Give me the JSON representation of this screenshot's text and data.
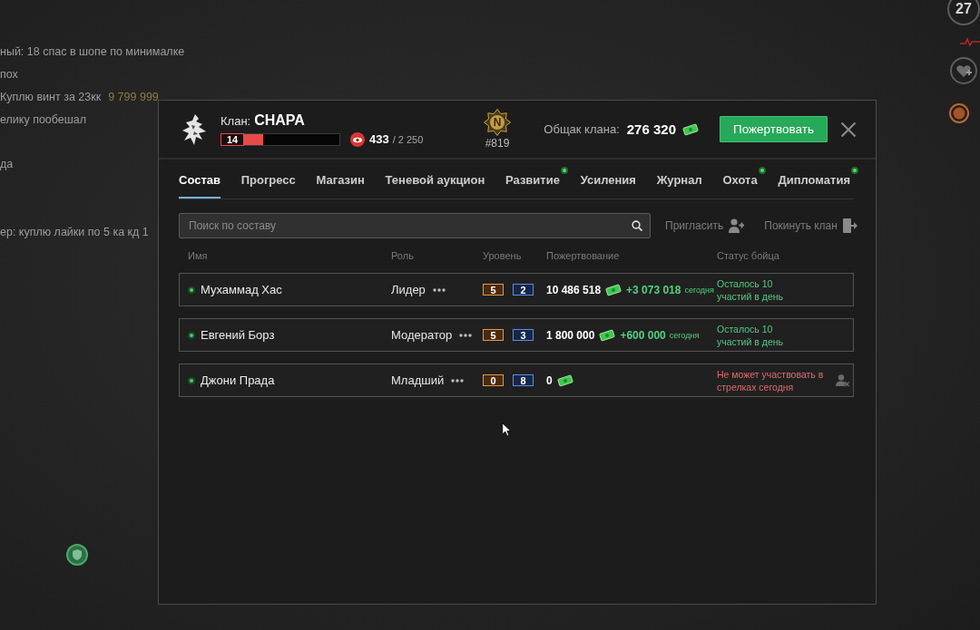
{
  "chat": [
    {
      "messages": [
        {
          "text": "ный: 18 спас в шопе по минималке"
        },
        {
          "text": "пох"
        },
        {
          "text": "Куплю винт за 23кк",
          "amount": "9 799 999"
        },
        {
          "text": "елику пообешал"
        }
      ]
    },
    {
      "messages": [
        {
          "text": "да"
        }
      ]
    },
    {
      "messages": [
        {
          "text": "ер: куплю лайки по 5 ка кд 1"
        }
      ]
    }
  ],
  "hud": {
    "counter": "27"
  },
  "clan": {
    "label": "Клан:",
    "name": "CHAPA",
    "clan_lvl": "14",
    "progress": {
      "level": 0.35
    },
    "points": "433",
    "points_max": "/ 2 250",
    "league_letter": "N",
    "rank": "#819",
    "treasury_label": "Общак клана:",
    "treasury": "276 320",
    "donate_button": "Пожертвовать"
  },
  "tabs": [
    {
      "label": "Состав",
      "selected": true,
      "notification": false
    },
    {
      "label": "Прогресс",
      "selected": false,
      "notification": false
    },
    {
      "label": "Магазин",
      "selected": false,
      "notification": false
    },
    {
      "label": "Теневой аукцион",
      "selected": false,
      "notification": false
    },
    {
      "label": "Развитие",
      "selected": false,
      "notification": true
    },
    {
      "label": "Усиления",
      "selected": false,
      "notification": false
    },
    {
      "label": "Журнал",
      "selected": false,
      "notification": false
    },
    {
      "label": "Охота",
      "selected": false,
      "notification": true
    },
    {
      "label": "Дипломатия",
      "selected": false,
      "notification": true
    }
  ],
  "search": {
    "placeholder": "Поиск по составу"
  },
  "actions": [
    {
      "label": "Пригласить",
      "kind": "invite"
    },
    {
      "label": "Покинуть клан",
      "kind": "leave"
    }
  ],
  "table": {
    "columns": [
      "Имя",
      "Роль",
      "Уровень",
      "Пожертвование",
      "Статус бойца"
    ],
    "rows": [
      {
        "online": true,
        "name": "Мухаммад Хас",
        "role": "Лидер",
        "grades": [
          {
            "value": "5",
            "kind": "primary"
          },
          {
            "value": "2",
            "kind": "secondary"
          }
        ],
        "donation": "10 486 518",
        "today": "+3 073 018",
        "today_label": "сегодня",
        "status_lines": [
          "Осталось 10",
          "участий в день"
        ],
        "can_participate": true,
        "removable": false
      },
      {
        "online": true,
        "name": "Евгений Борз",
        "role": "Модератор",
        "grades": [
          {
            "value": "5",
            "kind": "primary"
          },
          {
            "value": "3",
            "kind": "secondary"
          }
        ],
        "donation": "1 800 000",
        "today": "+600 000",
        "today_label": "сегодня",
        "status_lines": [
          "Осталось 10",
          "участий в день"
        ],
        "can_participate": true,
        "removable": false
      },
      {
        "online": true,
        "name": "Джони Прада",
        "role": "Младший",
        "grades": [
          {
            "value": "0",
            "kind": "primary"
          },
          {
            "value": "8",
            "kind": "secondary"
          }
        ],
        "donation": "0",
        "status_lines": [
          "Не может участвовать в",
          "стрелках сегодня"
        ],
        "can_participate": false,
        "removable": true
      }
    ]
  }
}
